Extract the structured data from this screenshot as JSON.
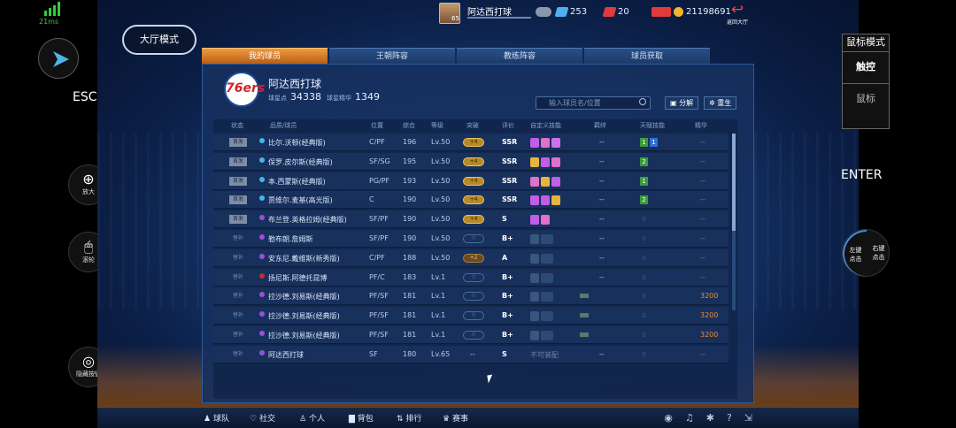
{
  "status": {
    "signal_time": "21ms"
  },
  "overlay": {
    "esc": "ESC",
    "enter": "ENTER",
    "zoom": "放大",
    "wheel": "滚轮",
    "hide_keys": "隐藏按键",
    "mode_title": "鼠标模式",
    "touch": "触控",
    "mouse": "鼠标",
    "left_click": "左键\n点击",
    "right_click": "右键\n点击"
  },
  "topbar": {
    "player_name": "阿达西打球",
    "player_level": "65",
    "diamonds": "253",
    "tickets": "20",
    "coins": "21198691",
    "back_label": "返回大厅"
  },
  "mode_button": "大厅模式",
  "tabs": [
    {
      "label": "我的球员",
      "active": true
    },
    {
      "label": "王朝阵容"
    },
    {
      "label": "教练阵容"
    },
    {
      "label": "球员获取"
    }
  ],
  "team": {
    "logo": "76ers",
    "name": "阿达西打球",
    "points_label": "球星点",
    "points": "34338",
    "essence_label": "球星精华",
    "essence": "1349"
  },
  "search": {
    "placeholder": "输入球员名/位置"
  },
  "buttons": {
    "decompose": "分解",
    "rebirth": "重生"
  },
  "columns": [
    "状态",
    "品质/球员",
    "位置",
    "综合",
    "等级",
    "突破",
    "评价",
    "自定义技能",
    "羁绊",
    "天赋技能",
    "精华"
  ],
  "rows": [
    {
      "status": "首发",
      "name": "比尔.沃顿(经典版)",
      "pos": "C/PF",
      "ovr": "196",
      "lv": "Lv.50",
      "brk": "+4",
      "rating": "SSR",
      "bond": "--",
      "talent": [
        "1",
        "1"
      ],
      "ess": "--",
      "dot": "#46b7e8"
    },
    {
      "status": "首发",
      "name": "保罗.皮尔斯(经典版)",
      "pos": "SF/SG",
      "ovr": "195",
      "lv": "Lv.50",
      "brk": "+4",
      "rating": "SSR",
      "bond": "--",
      "talent": [
        "2"
      ],
      "ess": "--",
      "dot": "#46b7e8"
    },
    {
      "status": "首发",
      "name": "本.西蒙斯(经典版)",
      "pos": "PG/PF",
      "ovr": "193",
      "lv": "Lv.50",
      "brk": "+4",
      "rating": "SSR",
      "bond": "--",
      "talent": [
        "1"
      ],
      "ess": "--",
      "dot": "#46b7e8"
    },
    {
      "status": "首发",
      "name": "贾维尔.麦基(高光版)",
      "pos": "C",
      "ovr": "190",
      "lv": "Lv.50",
      "brk": "+4",
      "rating": "SSR",
      "bond": "--",
      "talent": [
        "2"
      ],
      "ess": "--",
      "dot": "#46b7e8"
    },
    {
      "status": "首发",
      "name": "布兰登.英格拉姆(经典版)",
      "pos": "SF/PF",
      "ovr": "190",
      "lv": "Lv.50",
      "brk": "+4",
      "rating": "S",
      "bond": "--",
      "talent": [
        "0"
      ],
      "ess": "--",
      "dot": "#9a4fe0"
    },
    {
      "status": "替补",
      "name": "勒布朗.詹姆斯",
      "pos": "SF/PF",
      "ovr": "190",
      "lv": "Lv.50",
      "brk": "0",
      "rating": "B+",
      "bond": "--",
      "talent": [
        "0"
      ],
      "ess": "--",
      "dot": "#9a4fe0"
    },
    {
      "status": "替补",
      "name": "安东尼.戴维斯(新秀版)",
      "pos": "C/PF",
      "ovr": "188",
      "lv": "Lv.50",
      "brk": "+2",
      "rating": "A",
      "bond": "--",
      "talent": [
        "0"
      ],
      "ess": "--",
      "dot": "#9a4fe0"
    },
    {
      "status": "替补",
      "name": "扬尼斯.阿德托昆博",
      "pos": "PF/C",
      "ovr": "183",
      "lv": "Lv.1",
      "brk": "0",
      "rating": "B+",
      "bond": "--",
      "talent": [
        "0"
      ],
      "ess": "--",
      "dot": "#c0302f"
    },
    {
      "status": "替补",
      "name": "拉沙德.刘易斯(经典版)",
      "pos": "PF/SF",
      "ovr": "181",
      "lv": "Lv.1",
      "brk": "0",
      "rating": "B+",
      "bond": "",
      "talent": [
        "0"
      ],
      "ess": "3200",
      "dot": "#9a4fe0"
    },
    {
      "status": "替补",
      "name": "拉沙德.刘易斯(经典版)",
      "pos": "PF/SF",
      "ovr": "181",
      "lv": "Lv.1",
      "brk": "0",
      "rating": "B+",
      "bond": "",
      "talent": [
        "0"
      ],
      "ess": "3200",
      "dot": "#9a4fe0"
    },
    {
      "status": "替补",
      "name": "拉沙德.刘易斯(经典版)",
      "pos": "PF/SF",
      "ovr": "181",
      "lv": "Lv.1",
      "brk": "0",
      "rating": "B+",
      "bond": "",
      "talent": [
        "0"
      ],
      "ess": "3200",
      "dot": "#9a4fe0"
    },
    {
      "status": "替补",
      "name": "阿达西打球",
      "pos": "SF",
      "ovr": "180",
      "lv": "Lv.65",
      "brk": "--",
      "rating": "S",
      "bond": "--",
      "talent": [
        "0"
      ],
      "ess": "--",
      "dot": "#9a4fe0",
      "custom": "不可装配"
    }
  ],
  "bottom_nav": [
    "球队",
    "社交",
    "个人",
    "背包",
    "排行",
    "赛事"
  ]
}
